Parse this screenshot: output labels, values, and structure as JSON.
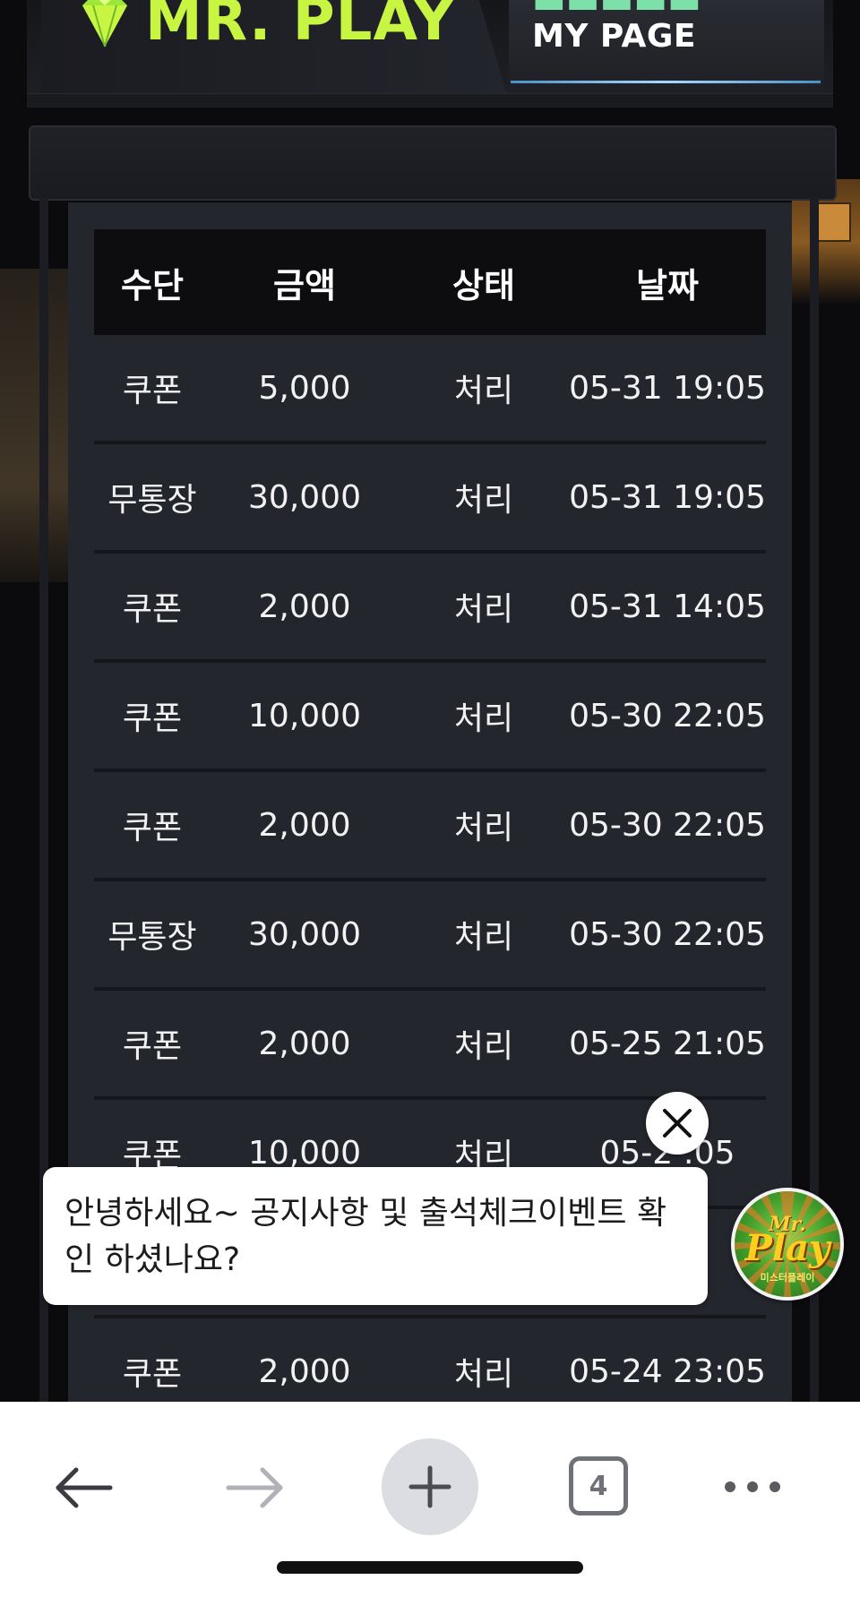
{
  "header": {
    "logo_text": "MR. PLAY",
    "subtitle": "MY PAGE",
    "accent_color": "#c8f542"
  },
  "table": {
    "headers": [
      "수단",
      "금액",
      "상태",
      "날짜"
    ],
    "rows": [
      {
        "method": "쿠폰",
        "amount": "5,000",
        "status": "처리",
        "date": "05-31 19:05"
      },
      {
        "method": "무통장",
        "amount": "30,000",
        "status": "처리",
        "date": "05-31 19:05"
      },
      {
        "method": "쿠폰",
        "amount": "2,000",
        "status": "처리",
        "date": "05-31 14:05"
      },
      {
        "method": "쿠폰",
        "amount": "10,000",
        "status": "처리",
        "date": "05-30 22:05"
      },
      {
        "method": "쿠폰",
        "amount": "2,000",
        "status": "처리",
        "date": "05-30 22:05"
      },
      {
        "method": "무통장",
        "amount": "30,000",
        "status": "처리",
        "date": "05-30 22:05"
      },
      {
        "method": "쿠폰",
        "amount": "2,000",
        "status": "처리",
        "date": "05-25 21:05"
      },
      {
        "method": "쿠폰",
        "amount": "10,000",
        "status": "처리",
        "date": "05-2  :05"
      },
      {
        "method": "",
        "amount": "",
        "status": "",
        "date": ""
      },
      {
        "method": "쿠폰",
        "amount": "2,000",
        "status": "처리",
        "date": "05-24 23:05"
      }
    ]
  },
  "chat": {
    "message": "안녕하세요~ 공지사항 및 출석체크이벤트 확인 하셨나요?",
    "avatar_line1": "Mr.",
    "avatar_line2": "Play",
    "avatar_line3": "미스터플레이"
  },
  "browser": {
    "tab_count": "4",
    "icons": [
      "back-arrow-icon",
      "forward-arrow-icon",
      "plus-icon",
      "tabs-icon",
      "more-icon"
    ]
  }
}
